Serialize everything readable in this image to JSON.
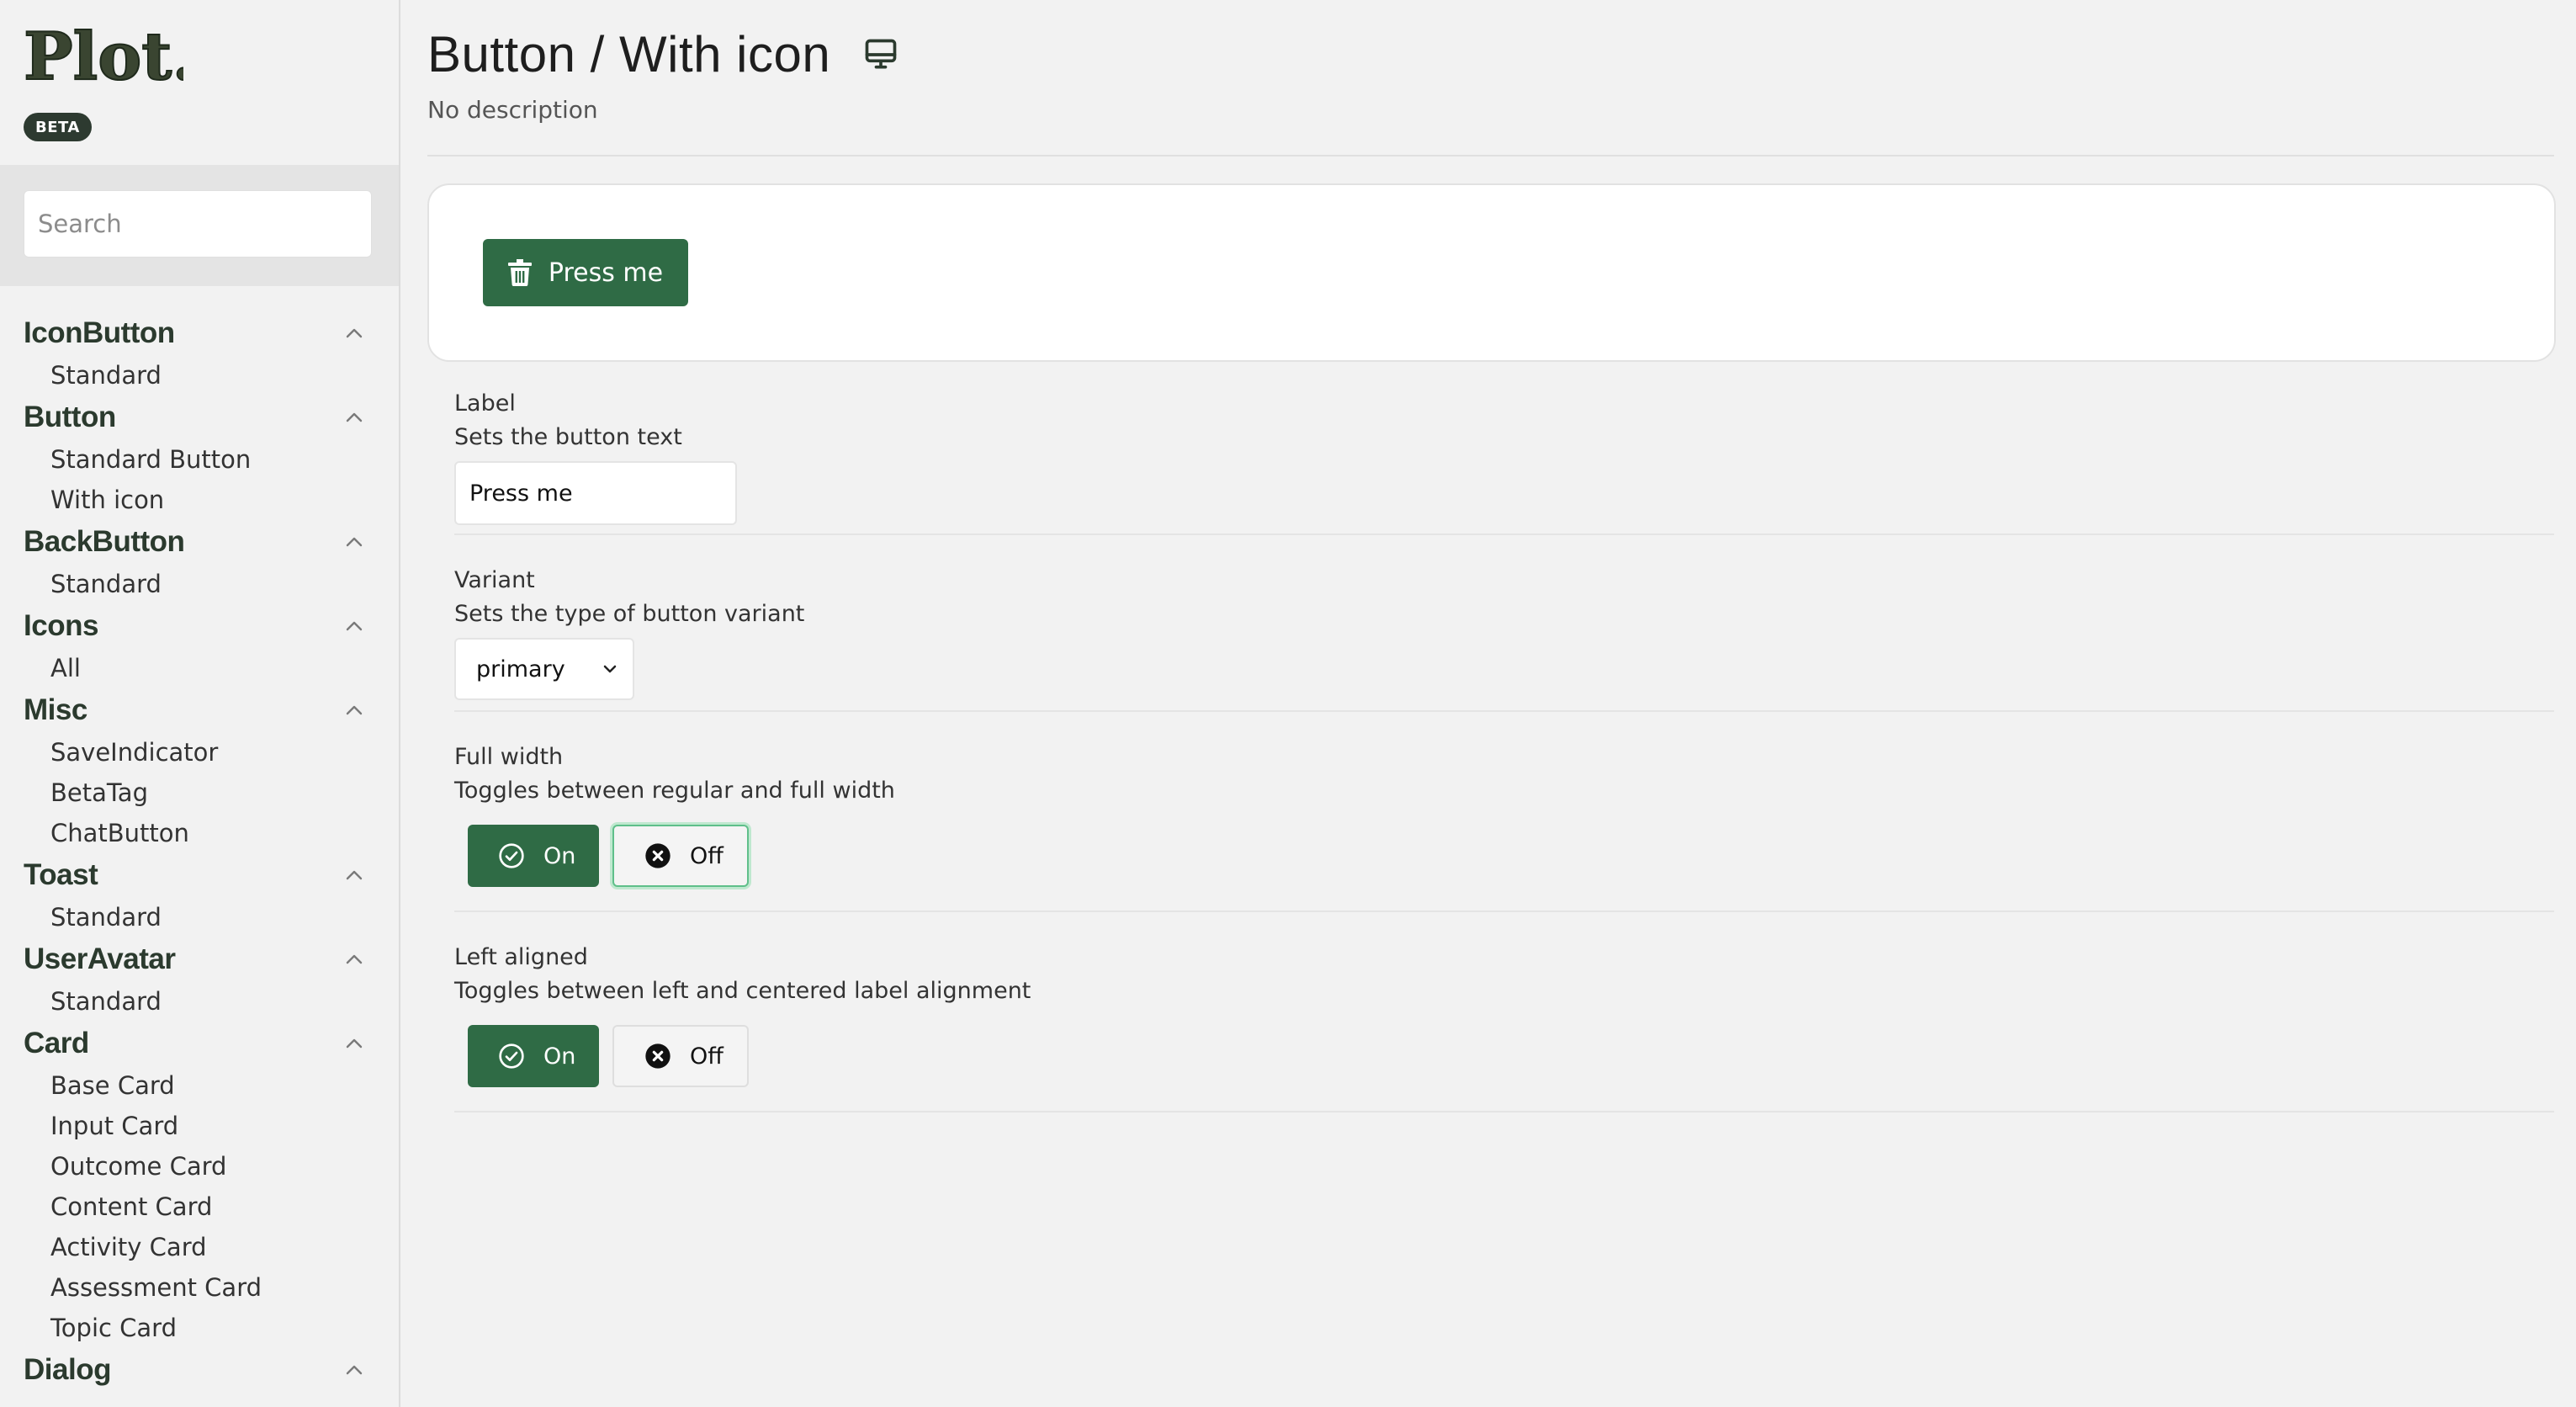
{
  "logo": {
    "text": "Plot.",
    "badge": "BETA"
  },
  "search": {
    "placeholder": "Search",
    "value": ""
  },
  "sidebar": {
    "groups": [
      {
        "title": "IconButton",
        "expanded": true,
        "items": [
          "Standard"
        ]
      },
      {
        "title": "Button",
        "expanded": true,
        "items": [
          "Standard Button",
          "With icon"
        ]
      },
      {
        "title": "BackButton",
        "expanded": true,
        "items": [
          "Standard"
        ]
      },
      {
        "title": "Icons",
        "expanded": true,
        "items": [
          "All"
        ]
      },
      {
        "title": "Misc",
        "expanded": true,
        "items": [
          "SaveIndicator",
          "BetaTag",
          "ChatButton"
        ]
      },
      {
        "title": "Toast",
        "expanded": true,
        "items": [
          "Standard"
        ]
      },
      {
        "title": "UserAvatar",
        "expanded": true,
        "items": [
          "Standard"
        ]
      },
      {
        "title": "Card",
        "expanded": true,
        "items": [
          "Base Card",
          "Input Card",
          "Outcome Card",
          "Content Card",
          "Activity Card",
          "Assessment Card",
          "Topic Card"
        ]
      },
      {
        "title": "Dialog",
        "expanded": true,
        "items": []
      }
    ]
  },
  "page": {
    "title": "Button / With icon",
    "description": "No description",
    "icon": "monitor-icon"
  },
  "preview": {
    "button_label": "Press me",
    "button_icon": "trash-icon"
  },
  "controls": {
    "label": {
      "title": "Label",
      "description": "Sets the button text",
      "value": "Press me"
    },
    "variant": {
      "title": "Variant",
      "description": "Sets the type of button variant",
      "selected": "primary"
    },
    "full_width": {
      "title": "Full width",
      "description": "Toggles between regular and full width",
      "on_label": "On",
      "off_label": "Off",
      "selected": "Off"
    },
    "left_aligned": {
      "title": "Left aligned",
      "description": "Toggles between left and centered label alignment",
      "on_label": "On",
      "off_label": "Off",
      "selected": "Off"
    }
  },
  "colors": {
    "primary_green": "#2f6b45",
    "nav_heading": "#2b3a2e",
    "focus_ring": "#5fbf8a"
  }
}
